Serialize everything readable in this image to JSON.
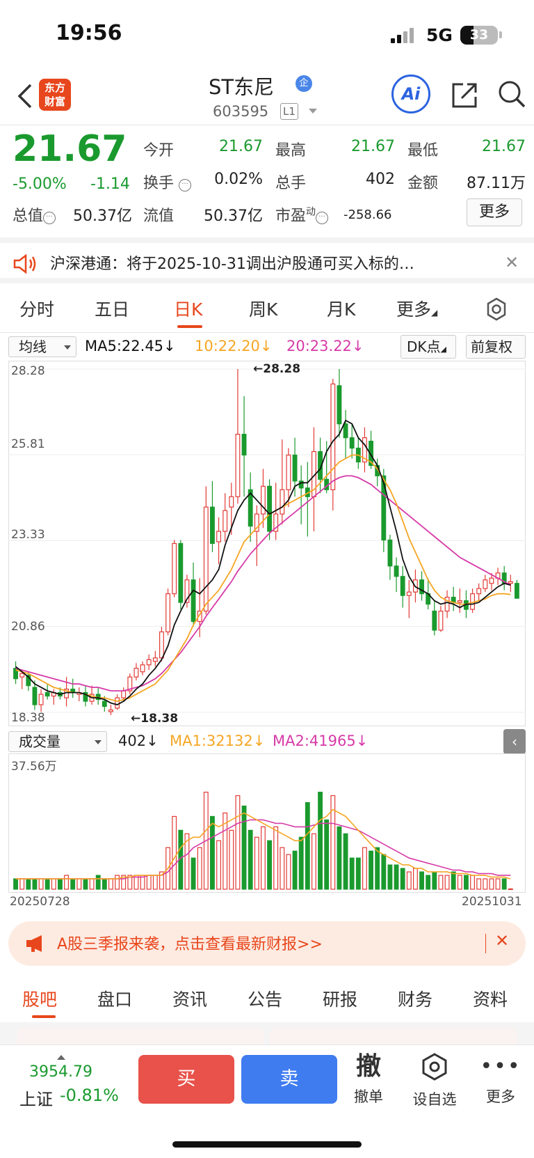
{
  "status": {
    "time": "19:56",
    "network": "5G",
    "battery": "33"
  },
  "header": {
    "logo_line1": "东方",
    "logo_line2": "财富",
    "name": "ST东尼",
    "qi_badge": "企",
    "code": "603595",
    "level": "L1",
    "ai_label": "Ai"
  },
  "quote": {
    "price": "21.67",
    "change_pct": "-5.00%",
    "change_amt": "-1.14",
    "open_label": "今开",
    "open": "21.67",
    "high_label": "最高",
    "high": "21.67",
    "low_label": "最低",
    "low": "21.67",
    "turnover_label": "换手",
    "turnover": "0.02%",
    "volume_label": "总手",
    "volume": "402",
    "amount_label": "金额",
    "amount": "87.11万",
    "mktcap_label": "总值",
    "mktcap": "50.37亿",
    "float_label": "流值",
    "float": "50.37亿",
    "pe_label": "市盈",
    "pe_sup": "动",
    "pe": "-258.66",
    "more": "更多"
  },
  "notice": {
    "text": "沪深港通：将于2025-10-31调出沪股通可买入标的…"
  },
  "chart_tabs": [
    "分时",
    "五日",
    "日K",
    "周K",
    "月K",
    "更多"
  ],
  "indicators": {
    "ma_selector": "均线",
    "ma5": "MA5:22.45↓",
    "ma10": "10:22.20↓",
    "ma20": "20:23.22↓",
    "dk": "DK点",
    "adjust": "前复权",
    "vol_selector": "成交量",
    "vol": "402↓",
    "vol_ma1": "MA1:32132↓",
    "vol_ma2": "MA2:41965↓"
  },
  "colors": {
    "up": "#e23a35",
    "down": "#1a9a2e",
    "ma5": "#111111",
    "ma10": "#f5a623",
    "ma20": "#d63aa8",
    "accent": "#e8461c"
  },
  "chart_data": {
    "type": "candlestick",
    "y_ticks": [
      "28.28",
      "25.81",
      "23.33",
      "20.86",
      "18.38"
    ],
    "ylim": [
      18.38,
      28.28
    ],
    "max_label": "28.28",
    "min_label": "18.38",
    "vol_max_label": "37.56万",
    "x_start": "20250728",
    "x_end": "20251031",
    "candles": [
      {
        "o": 19.65,
        "h": 19.85,
        "l": 19.2,
        "c": 19.35
      },
      {
        "o": 19.4,
        "h": 19.6,
        "l": 19.05,
        "c": 19.5
      },
      {
        "o": 19.45,
        "h": 19.55,
        "l": 19.0,
        "c": 19.15
      },
      {
        "o": 19.1,
        "h": 19.3,
        "l": 18.45,
        "c": 18.6
      },
      {
        "o": 18.6,
        "h": 19.05,
        "l": 18.4,
        "c": 18.9
      },
      {
        "o": 18.95,
        "h": 19.2,
        "l": 18.75,
        "c": 18.85
      },
      {
        "o": 18.85,
        "h": 19.05,
        "l": 18.6,
        "c": 18.95
      },
      {
        "o": 18.95,
        "h": 19.1,
        "l": 18.75,
        "c": 18.85
      },
      {
        "o": 18.8,
        "h": 19.4,
        "l": 18.55,
        "c": 19.05
      },
      {
        "o": 19.05,
        "h": 19.35,
        "l": 18.8,
        "c": 18.95
      },
      {
        "o": 18.9,
        "h": 19.1,
        "l": 18.7,
        "c": 18.95
      },
      {
        "o": 18.95,
        "h": 19.15,
        "l": 18.55,
        "c": 18.7
      },
      {
        "o": 18.7,
        "h": 19.15,
        "l": 18.6,
        "c": 18.9
      },
      {
        "o": 18.9,
        "h": 19.1,
        "l": 18.6,
        "c": 18.75
      },
      {
        "o": 18.7,
        "h": 18.85,
        "l": 18.4,
        "c": 18.55
      },
      {
        "o": 18.4,
        "h": 18.6,
        "l": 18.3,
        "c": 18.45
      },
      {
        "o": 18.5,
        "h": 18.9,
        "l": 18.45,
        "c": 18.8
      },
      {
        "o": 18.8,
        "h": 19.1,
        "l": 18.7,
        "c": 19.0
      },
      {
        "o": 19.0,
        "h": 19.5,
        "l": 18.9,
        "c": 19.4
      },
      {
        "o": 19.4,
        "h": 19.8,
        "l": 19.3,
        "c": 19.65
      },
      {
        "o": 19.55,
        "h": 19.85,
        "l": 19.45,
        "c": 19.75
      },
      {
        "o": 19.75,
        "h": 20.05,
        "l": 19.6,
        "c": 19.9
      },
      {
        "o": 19.85,
        "h": 20.15,
        "l": 19.7,
        "c": 19.95
      },
      {
        "o": 19.95,
        "h": 20.85,
        "l": 19.85,
        "c": 20.7
      },
      {
        "o": 20.7,
        "h": 21.95,
        "l": 20.6,
        "c": 21.8
      },
      {
        "o": 21.8,
        "h": 23.35,
        "l": 21.7,
        "c": 23.25
      },
      {
        "o": 23.25,
        "h": 23.35,
        "l": 21.35,
        "c": 21.55
      },
      {
        "o": 21.55,
        "h": 22.35,
        "l": 21.4,
        "c": 22.2
      },
      {
        "o": 22.2,
        "h": 22.7,
        "l": 20.85,
        "c": 21.0
      },
      {
        "o": 21.0,
        "h": 22.25,
        "l": 20.55,
        "c": 21.3
      },
      {
        "o": 21.3,
        "h": 24.9,
        "l": 21.2,
        "c": 24.3
      },
      {
        "o": 24.3,
        "h": 25.05,
        "l": 23.0,
        "c": 23.25
      },
      {
        "o": 23.3,
        "h": 24.0,
        "l": 22.65,
        "c": 23.6
      },
      {
        "o": 23.6,
        "h": 24.7,
        "l": 23.3,
        "c": 24.2
      },
      {
        "o": 24.3,
        "h": 25.0,
        "l": 23.5,
        "c": 24.6
      },
      {
        "o": 24.6,
        "h": 28.28,
        "l": 24.4,
        "c": 26.4
      },
      {
        "o": 26.4,
        "h": 27.5,
        "l": 24.6,
        "c": 25.8
      },
      {
        "o": 24.8,
        "h": 25.3,
        "l": 23.3,
        "c": 23.75
      },
      {
        "o": 23.6,
        "h": 24.35,
        "l": 22.6,
        "c": 24.1
      },
      {
        "o": 24.1,
        "h": 25.4,
        "l": 23.7,
        "c": 24.9
      },
      {
        "o": 24.9,
        "h": 25.1,
        "l": 23.35,
        "c": 23.6
      },
      {
        "o": 23.6,
        "h": 25.0,
        "l": 23.35,
        "c": 24.1
      },
      {
        "o": 24.1,
        "h": 26.25,
        "l": 23.8,
        "c": 24.8
      },
      {
        "o": 24.8,
        "h": 26.0,
        "l": 24.3,
        "c": 25.8
      },
      {
        "o": 25.8,
        "h": 26.3,
        "l": 24.6,
        "c": 25.05
      },
      {
        "o": 25.05,
        "h": 25.5,
        "l": 23.8,
        "c": 24.85
      },
      {
        "o": 24.85,
        "h": 25.6,
        "l": 23.45,
        "c": 24.6
      },
      {
        "o": 24.6,
        "h": 26.6,
        "l": 23.6,
        "c": 25.9
      },
      {
        "o": 25.9,
        "h": 26.3,
        "l": 24.7,
        "c": 25.1
      },
      {
        "o": 25.1,
        "h": 26.2,
        "l": 24.7,
        "c": 24.8
      },
      {
        "o": 24.8,
        "h": 28.0,
        "l": 24.2,
        "c": 27.85
      },
      {
        "o": 27.8,
        "h": 28.28,
        "l": 26.3,
        "c": 26.7
      },
      {
        "o": 26.7,
        "h": 27.1,
        "l": 25.7,
        "c": 26.3
      },
      {
        "o": 26.3,
        "h": 26.7,
        "l": 25.7,
        "c": 26.0
      },
      {
        "o": 26.0,
        "h": 26.3,
        "l": 25.4,
        "c": 25.6
      },
      {
        "o": 25.6,
        "h": 26.6,
        "l": 25.3,
        "c": 26.3
      },
      {
        "o": 26.2,
        "h": 26.5,
        "l": 25.4,
        "c": 25.5
      },
      {
        "o": 25.5,
        "h": 25.7,
        "l": 24.9,
        "c": 25.2
      },
      {
        "o": 25.2,
        "h": 25.4,
        "l": 23.0,
        "c": 23.35
      },
      {
        "o": 23.35,
        "h": 23.5,
        "l": 22.2,
        "c": 22.6
      },
      {
        "o": 22.6,
        "h": 22.85,
        "l": 21.85,
        "c": 22.3
      },
      {
        "o": 22.3,
        "h": 22.6,
        "l": 21.4,
        "c": 21.75
      },
      {
        "o": 21.75,
        "h": 22.2,
        "l": 21.1,
        "c": 21.85
      },
      {
        "o": 21.85,
        "h": 22.5,
        "l": 21.55,
        "c": 22.2
      },
      {
        "o": 22.2,
        "h": 22.45,
        "l": 21.6,
        "c": 21.8
      },
      {
        "o": 21.8,
        "h": 22.25,
        "l": 21.35,
        "c": 21.5
      },
      {
        "o": 21.3,
        "h": 21.6,
        "l": 20.6,
        "c": 20.75
      },
      {
        "o": 20.75,
        "h": 21.45,
        "l": 20.7,
        "c": 21.3
      },
      {
        "o": 21.3,
        "h": 21.9,
        "l": 21.1,
        "c": 21.7
      },
      {
        "o": 21.7,
        "h": 22.0,
        "l": 21.3,
        "c": 21.55
      },
      {
        "o": 21.55,
        "h": 21.95,
        "l": 21.25,
        "c": 21.6
      },
      {
        "o": 21.6,
        "h": 21.9,
        "l": 21.1,
        "c": 21.35
      },
      {
        "o": 21.35,
        "h": 21.95,
        "l": 21.25,
        "c": 21.8
      },
      {
        "o": 21.8,
        "h": 22.1,
        "l": 21.6,
        "c": 21.95
      },
      {
        "o": 21.95,
        "h": 22.35,
        "l": 21.85,
        "c": 22.2
      },
      {
        "o": 22.1,
        "h": 22.4,
        "l": 21.9,
        "c": 22.25
      },
      {
        "o": 22.25,
        "h": 22.55,
        "l": 22.05,
        "c": 22.4
      },
      {
        "o": 22.4,
        "h": 22.6,
        "l": 21.9,
        "c": 22.1
      },
      {
        "o": 22.1,
        "h": 22.35,
        "l": 21.85,
        "c": 22.15
      },
      {
        "o": 22.1,
        "h": 22.2,
        "l": 21.67,
        "c": 21.67
      }
    ],
    "volume": [
      3,
      3,
      3,
      3,
      3,
      3,
      3,
      3,
      4,
      3,
      3,
      3,
      3,
      4,
      3,
      3,
      4,
      4,
      4,
      4,
      4,
      4,
      4,
      5,
      12,
      21,
      17,
      16,
      9,
      12,
      28,
      21,
      14,
      22,
      17,
      27,
      24,
      17,
      15,
      18,
      14,
      18,
      12,
      10,
      11,
      15,
      25,
      16,
      28,
      20,
      27,
      18,
      16,
      9,
      9,
      12,
      11,
      12,
      10,
      7,
      7,
      6,
      5,
      6,
      5,
      4,
      5,
      4,
      4,
      5,
      4,
      4,
      4,
      3,
      3,
      3,
      3,
      3,
      0.1
    ],
    "ma5": [
      19.7,
      19.55,
      19.4,
      19.2,
      19.1,
      19.0,
      18.95,
      18.9,
      18.95,
      18.95,
      18.95,
      18.9,
      18.8,
      18.8,
      18.75,
      18.65,
      18.6,
      18.7,
      18.85,
      19.05,
      19.2,
      19.45,
      19.65,
      19.9,
      20.3,
      20.9,
      21.3,
      21.65,
      21.9,
      21.8,
      22.0,
      22.2,
      22.5,
      23.2,
      23.7,
      24.2,
      24.5,
      24.7,
      24.5,
      24.3,
      24.1,
      24.2,
      24.3,
      24.5,
      24.9,
      25.0,
      25.0,
      25.2,
      25.4,
      25.9,
      26.2,
      26.4,
      26.8,
      26.7,
      26.3,
      26.1,
      25.8,
      25.5,
      25.0,
      24.3,
      23.6,
      22.8,
      22.3,
      22.0,
      21.9,
      21.8,
      21.6,
      21.5,
      21.55,
      21.5,
      21.4,
      21.5,
      21.5,
      21.55,
      21.7,
      21.85,
      22.0,
      22.1,
      22.05
    ],
    "ma10": [
      19.6,
      19.55,
      19.5,
      19.4,
      19.3,
      19.2,
      19.1,
      19.05,
      19.0,
      18.95,
      18.95,
      18.9,
      18.85,
      18.8,
      18.8,
      18.75,
      18.7,
      18.75,
      18.8,
      18.9,
      19.0,
      19.1,
      19.2,
      19.4,
      19.6,
      19.9,
      20.2,
      20.5,
      20.9,
      21.2,
      21.5,
      21.7,
      21.9,
      22.2,
      22.5,
      22.9,
      23.3,
      23.5,
      23.7,
      23.9,
      24.1,
      24.2,
      24.3,
      24.4,
      24.5,
      24.6,
      24.7,
      24.8,
      25.0,
      25.2,
      25.4,
      25.6,
      25.7,
      25.8,
      25.8,
      25.7,
      25.6,
      25.4,
      25.1,
      24.8,
      24.4,
      23.9,
      23.4,
      23.0,
      22.6,
      22.2,
      21.9,
      21.7,
      21.6,
      21.55,
      21.5,
      21.5,
      21.55,
      21.6,
      21.65,
      21.75,
      21.8,
      21.8,
      21.78
    ],
    "ma20": [
      19.65,
      19.6,
      19.55,
      19.5,
      19.45,
      19.4,
      19.35,
      19.3,
      19.25,
      19.2,
      19.2,
      19.15,
      19.1,
      19.1,
      19.05,
      19.0,
      19.0,
      19.0,
      19.05,
      19.1,
      19.15,
      19.25,
      19.35,
      19.5,
      19.7,
      19.9,
      20.1,
      20.35,
      20.6,
      20.85,
      21.15,
      21.4,
      21.65,
      21.9,
      22.15,
      22.45,
      22.7,
      22.95,
      23.15,
      23.35,
      23.55,
      23.7,
      23.85,
      24.0,
      24.15,
      24.3,
      24.45,
      24.6,
      24.75,
      24.9,
      25.05,
      25.15,
      25.2,
      25.2,
      25.15,
      25.05,
      24.95,
      24.8,
      24.65,
      24.5,
      24.35,
      24.2,
      24.05,
      23.9,
      23.75,
      23.6,
      23.45,
      23.3,
      23.15,
      23.0,
      22.85,
      22.75,
      22.65,
      22.55,
      22.45,
      22.35,
      22.25,
      22.15,
      22.05
    ],
    "vol_ma1": [
      3,
      3,
      3,
      3,
      3,
      3,
      3,
      3,
      3,
      3,
      3,
      3,
      3,
      3,
      3,
      3,
      3,
      3.5,
      3.5,
      4,
      4,
      4,
      4,
      4,
      6,
      9,
      12,
      14,
      15,
      15,
      17,
      19,
      18,
      19,
      20,
      21,
      22,
      21,
      20,
      19,
      18,
      17,
      16,
      15,
      14,
      14,
      16,
      18,
      20,
      21,
      23,
      22,
      21,
      19,
      17,
      15,
      13,
      11,
      10,
      9,
      8,
      7,
      7,
      6,
      6,
      5,
      5,
      5,
      5,
      4.5,
      4.5,
      4.5,
      4,
      4,
      4,
      3.5,
      3.5,
      3.5,
      3
    ],
    "vol_ma2": [
      3,
      3,
      3,
      3,
      3,
      3,
      3,
      3,
      3,
      3,
      3,
      3,
      3,
      3,
      3,
      3,
      3,
      3,
      3.5,
      3.5,
      3.5,
      4,
      4,
      4,
      5,
      7,
      9,
      10,
      12,
      13,
      14,
      15,
      16,
      17,
      18,
      19,
      19.5,
      20,
      20,
      20,
      19.5,
      19,
      19,
      18.5,
      18,
      18,
      18,
      18.5,
      19,
      19,
      19,
      18.5,
      18,
      17.5,
      17,
      16,
      15,
      14,
      13,
      12,
      11,
      10,
      9,
      8.5,
      8,
      7.5,
      7,
      6.5,
      6,
      5.5,
      5.5,
      5,
      5,
      4.5,
      4.5,
      4.5,
      4,
      4,
      4
    ]
  },
  "ad": {
    "text": "A股三季报来袭，点击查看最新财报>>"
  },
  "bottom_tabs": [
    "股吧",
    "盘口",
    "资讯",
    "公告",
    "研报",
    "财务",
    "资料"
  ],
  "toolbar": {
    "index_value": "3954.79",
    "index_name": "上证",
    "index_pct": "-0.81%",
    "buy": "买",
    "sell": "卖",
    "cancel_glyph": "撤",
    "cancel": "撤单",
    "watch": "设自选",
    "more": "更多"
  }
}
